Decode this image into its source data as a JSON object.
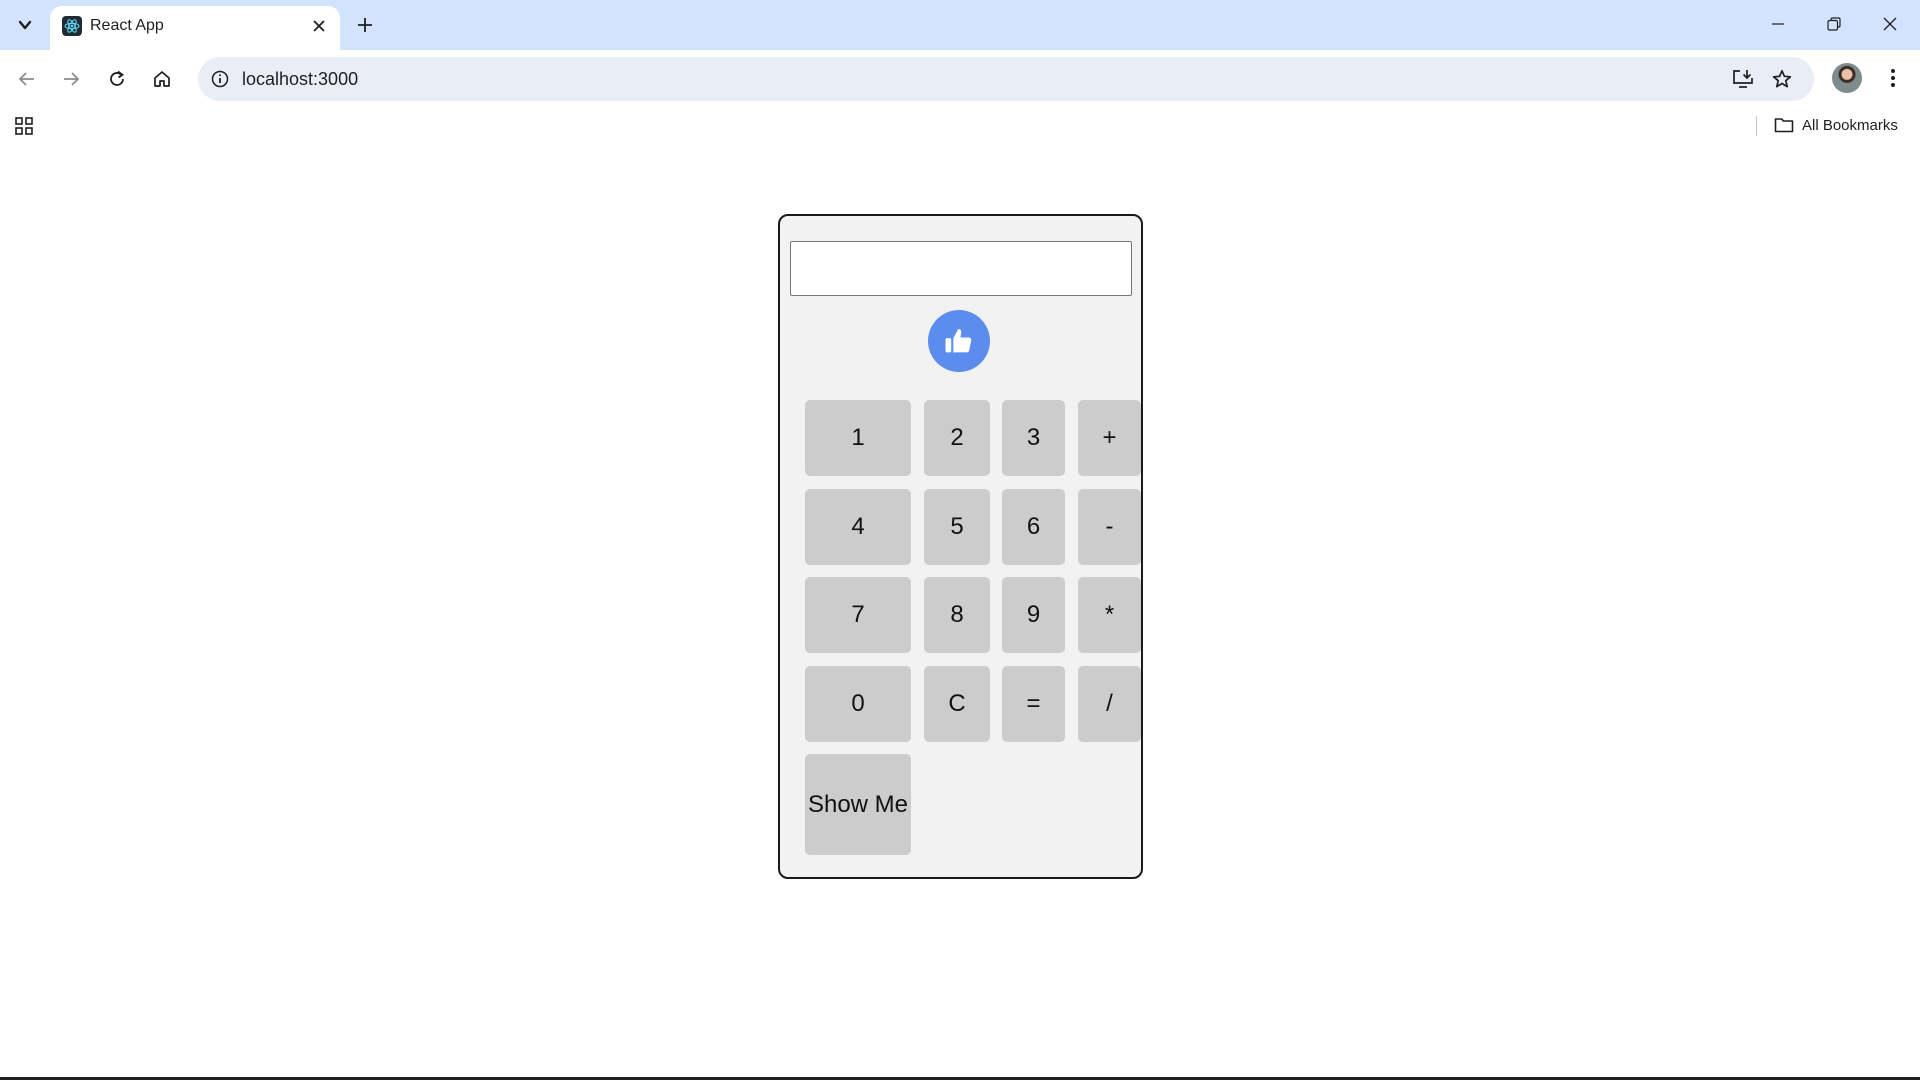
{
  "browser": {
    "tab_title": "React App",
    "url": "localhost:3000",
    "bookmarks_label": "All Bookmarks"
  },
  "calculator": {
    "display_value": "",
    "keys": {
      "one": "1",
      "two": "2",
      "three": "3",
      "plus": "+",
      "four": "4",
      "five": "5",
      "six": "6",
      "minus": "-",
      "seven": "7",
      "eight": "8",
      "nine": "9",
      "multiply": "*",
      "zero": "0",
      "clear": "C",
      "equals": "=",
      "divide": "/",
      "show_me": "Show Me"
    },
    "like_icon": "thumbs-up-icon"
  },
  "colors": {
    "tabstrip": "#d3e3fd",
    "omnibox": "#e9eef6",
    "calculator_bg": "#f2f2f2",
    "key_bg": "#cccccc",
    "like_button": "#5b8def"
  }
}
